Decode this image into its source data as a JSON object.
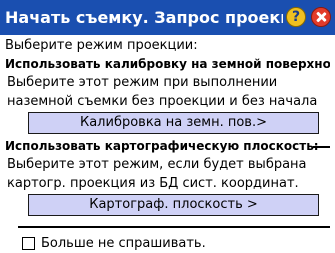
{
  "titlebar": {
    "title": "Начать съемку. Запрос проекци",
    "help_icon": "help-icon",
    "close_icon": "close-icon"
  },
  "prompt": "Выберите режим проекции:",
  "ground": {
    "heading": "Использовать калибровку на земной поверхнос",
    "desc_line1": "Выберите этот режим при выполнении",
    "desc_line2": "наземной съемки без проекции и без начала",
    "button": "Калибровка на земн. пов.>"
  },
  "map": {
    "heading": "Использовать картографическую плоскость:",
    "desc_line1": "Выберите этот режим, если будет выбрана",
    "desc_line2": "картогр. проекция из БД сист. координат.",
    "button": "Картограф. плоскость >"
  },
  "dont_ask": {
    "label": "Больше не спрашивать.",
    "checked": false
  },
  "colors": {
    "titlebar": "#1a4fb0",
    "button_bg": "#cfd1f6"
  }
}
